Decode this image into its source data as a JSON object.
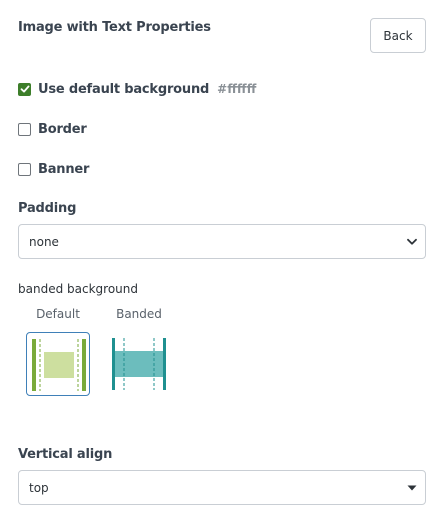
{
  "panel": {
    "title": "Image with Text Properties",
    "back_label": "Back"
  },
  "options": {
    "default_background": {
      "label": "Use default background",
      "checked": true,
      "color_value": "#ffffff"
    },
    "border": {
      "label": "Border",
      "checked": false
    },
    "banner": {
      "label": "Banner",
      "checked": false
    }
  },
  "padding": {
    "label": "Padding",
    "selected": "none"
  },
  "banded_background": {
    "label": "banded background",
    "choices": [
      {
        "label": "Default",
        "selected": true,
        "color": "#7aaa3a",
        "fill": "#cddf9f"
      },
      {
        "label": "Banded",
        "selected": false,
        "color": "#1f9090",
        "fill": "#6cbdbd"
      }
    ]
  },
  "vertical_align": {
    "label": "Vertical align",
    "selected": "top"
  },
  "colors": {
    "checkbox_accent": "#3d7e2a",
    "selected_outline": "#3f80b8",
    "heading_text": "#3a4450"
  }
}
